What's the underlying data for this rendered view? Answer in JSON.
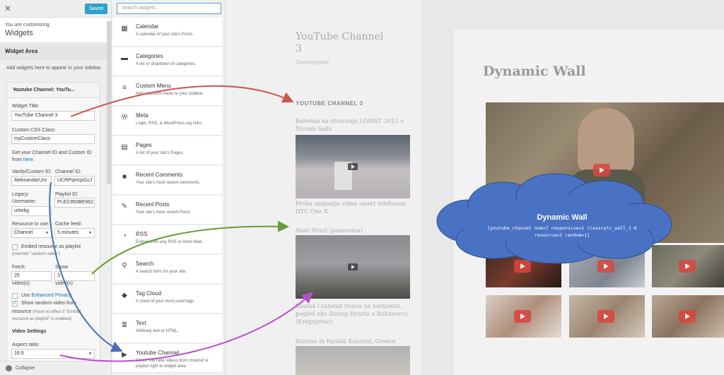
{
  "customizer": {
    "saved_label": "Saved",
    "customizing_label": "You are customizing",
    "customizing_title": "Widgets",
    "section_title": "Widget Area",
    "section_desc": "Add widgets here to appear in your sidebar.",
    "widget_header": "Youtube Channel: YouTu...",
    "widget_title_label": "Widget Title:",
    "widget_title_value": "YouTube Channel 3",
    "css_class_label": "Custom CSS Class:",
    "css_class_value": "myCustomClass",
    "channel_help_text": "Get your Channel ID and Custom ID from",
    "channel_help_link": "here",
    "vanity_label": "Vanity/Custom ID:",
    "vanity_value": "AleksandarUro",
    "channel_id_label": "Channel ID:",
    "channel_id_value": "UCRPqmcpGcJ",
    "legacy_label_line1": "Legacy",
    "legacy_label_line2": "Username:",
    "legacy_value": "urkekg",
    "playlist_label": "Playlist ID:",
    "playlist_value": "PLEC850BE962",
    "resource_label": "Resource to use:",
    "resource_value": "Channel",
    "cache_label": "Cache feed:",
    "cache_value": "5 minutes",
    "embed_playlist_label": "Embed resource as playlist",
    "embed_playlist_note": "(override \"random video\")",
    "fetch_label": "Fetch:",
    "fetch_value": "25",
    "fetch_unit": "video(s)",
    "show_label": "Show:",
    "show_value": "3",
    "show_unit": "video(s)",
    "enhanced_privacy_prefix": "Use",
    "enhanced_privacy_link": "Enhanced Privacy",
    "random_video_line1": "Show random video from",
    "random_video_line2": "resource",
    "random_video_note": "(Have no effect if \"Embed resource as playlist\" is enabled)",
    "video_settings_label": "Video Settings",
    "aspect_label": "Aspect ratio:",
    "aspect_value": "16:9",
    "collapse_label": "Collapse"
  },
  "widgets_panel": {
    "search_placeholder": "Search widgets...",
    "items": [
      {
        "name": "Calendar",
        "desc": "A calendar of your site's Posts.",
        "icon": "calendar-icon",
        "glyph": "▦"
      },
      {
        "name": "Categories",
        "desc": "A list or dropdown of categories.",
        "icon": "folder-icon",
        "glyph": "▬"
      },
      {
        "name": "Custom Menu",
        "desc": "Add a custom menu to your sidebar.",
        "icon": "menu-icon",
        "glyph": "≡"
      },
      {
        "name": "Meta",
        "desc": "Login, RSS, & WordPress.org links.",
        "icon": "wordpress-icon",
        "glyph": "Ⓦ"
      },
      {
        "name": "Pages",
        "desc": "A list of your site's Pages.",
        "icon": "page-icon",
        "glyph": "▤"
      },
      {
        "name": "Recent Comments",
        "desc": "Your site's most recent comments.",
        "icon": "comment-icon",
        "glyph": "■"
      },
      {
        "name": "Recent Posts",
        "desc": "Your site's most recent Posts.",
        "icon": "pin-icon",
        "glyph": "✎"
      },
      {
        "name": "RSS",
        "desc": "Entries from any RSS or Atom feed.",
        "icon": "rss-icon",
        "glyph": "◔"
      },
      {
        "name": "Search",
        "desc": "A search form for your site.",
        "icon": "search-icon",
        "glyph": "⚲"
      },
      {
        "name": "Tag Cloud",
        "desc": "A cloud of your most used tags.",
        "icon": "tag-icon",
        "glyph": "◆"
      },
      {
        "name": "Text",
        "desc": "Arbitrary text or HTML.",
        "icon": "text-icon",
        "glyph": "≣"
      },
      {
        "name": "Youtube Channel",
        "desc": "Serve YouTube videos from channel or playlist right to widget area",
        "icon": "video-icon",
        "glyph": "▶"
      }
    ]
  },
  "preview1": {
    "site_title_line1": "YouTube Channel",
    "site_title_line2": "3",
    "site_subtitle": "Development",
    "widget_title": "YOUTUBE CHANNEL 3",
    "video1_title": "Balerina na otvaranju LORIST 2012 u Novom Sadu",
    "video1_caption": "Proba snimanja videa smart telefonom HTC One X",
    "video2_title": "Stari Hrast (panorama)",
    "video2_caption": "Izlazak i zalazak Sunca na horizontu, pogled oko Starog Hrasta u Bukurovcu (Kragujevac)",
    "video3_title": "Sunrise in Paralia Katerini, Greece"
  },
  "preview2": {
    "title": "Dynamic Wall",
    "cloud_title": "Dynamic Wall",
    "cloud_code_line1": "[youtube_channel num=7 responsive=1 class=ytc_wall_1-6",
    "cloud_code_line2": "resource=2 random=1]"
  },
  "colors": {
    "accent": "#2ea2cc",
    "cloud": "#4a72c4",
    "arrow_red": "#c9574a",
    "arrow_green": "#6a9a3a",
    "arrow_blue": "#4a6fb5",
    "arrow_purple": "#b650c8"
  }
}
